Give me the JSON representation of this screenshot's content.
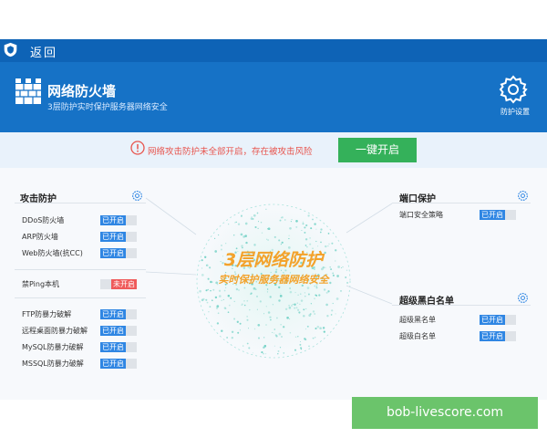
{
  "nav": {
    "back_label": "返回"
  },
  "header": {
    "title": "网络防火墙",
    "subtitle": "3层防护实时保护服务器网络安全",
    "settings_label": "防护设置"
  },
  "alert": {
    "message": "网络攻击防护未全部开启，存在被攻击风险",
    "enable_all_label": "一键开启"
  },
  "center": {
    "title": "3层网络防护",
    "subtitle": "实时保护服务器网络安全"
  },
  "attack": {
    "title": "攻击防护",
    "items": [
      {
        "label": "DDoS防火墙",
        "status": "已开启"
      },
      {
        "label": "ARP防火墙",
        "status": "已开启"
      },
      {
        "label": "Web防火墙(抗CC)",
        "status": "已开启"
      }
    ]
  },
  "ping": {
    "label": "禁Ping本机",
    "status": "未开启"
  },
  "brute": {
    "items": [
      {
        "label": "FTP防暴力破解",
        "status": "已开启"
      },
      {
        "label": "远程桌面防暴力破解",
        "status": "已开启"
      },
      {
        "label": "MySQL防暴力破解",
        "status": "已开启"
      },
      {
        "label": "MSSQL防暴力破解",
        "status": "已开启"
      }
    ]
  },
  "port": {
    "title": "端口保护",
    "items": [
      {
        "label": "端口安全策略",
        "status": "已开启"
      }
    ]
  },
  "lists": {
    "title": "超级黑白名单",
    "items": [
      {
        "label": "超级黑名单",
        "status": "已开启"
      },
      {
        "label": "超级白名单",
        "status": "已开启"
      }
    ]
  },
  "watermark": "bob-livescore.com",
  "colors": {
    "header": "#1672c6",
    "on": "#2f86e3",
    "off": "#ef5a5a",
    "accent": "#f3a22b",
    "button": "#34b15a"
  }
}
